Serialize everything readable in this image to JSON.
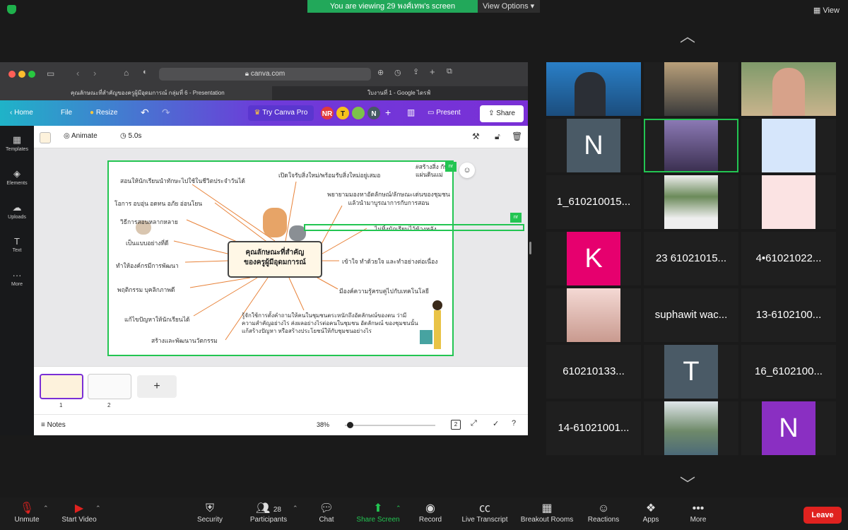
{
  "topbar": {
    "viewing": "You are viewing 29 พงศ์เทพ's screen",
    "view_options": "View Options ▾",
    "view": "View"
  },
  "safari": {
    "url": "canva.com"
  },
  "tabs": [
    {
      "label": "คุณลักษณะที่สำคัญของครูผู้มีอุดมการณ์ กลุ่มที่ 6 - Presentation"
    },
    {
      "label": "ใบงานที่ 1 - Google ไดรฟ์"
    }
  ],
  "canva": {
    "home": "Home",
    "file": "File",
    "resize": "Resize",
    "try_pro": "Try Canva Pro",
    "collab_badges": [
      "NR",
      "T",
      "N"
    ],
    "present": "Present",
    "share": "Share",
    "animate": "Animate",
    "duration": "5.0s"
  },
  "rail": [
    "Templates",
    "Elements",
    "Uploads",
    "Text",
    "More"
  ],
  "slide": {
    "center": [
      "คุณลักษณะที่สำคัญ",
      "ของครูผู้มีอุดมการณ์"
    ],
    "left": [
      "สอนให้นักเรียนนำทักษะไปใช้ในชีวิตประจำวันได้",
      "โอการ อบอุ่น อดทน อภัย อ่อนโยน",
      "วิธีการสอนหลากหลาย",
      "เป็นแบบอย่างที่ดี",
      "ทำให้องค์กรมีการพัฒนา",
      "พฤติกรรม บุคลิกภาพดี",
      "แก้ไขปัญหาให้นักเรียนได้",
      "สร้างและพัฒนานวัตกรรม"
    ],
    "right": [
      "เปิดใจรับสิ่งใหม่/พร้อมรับสิ่งใหม่อยู่เสมอ",
      "#สร้างสิ่ง กับแผ่นดินแม่",
      "พยายามมองหาอัตลักษณ์/ลักษณะเด่นของชุมชน แล้วนำมาบูรณาการกับการสอน",
      "ไม่ทิ้งนักเรียนไว้ข้างหลัง",
      "เข้าใจ ทำด้วยใจ และทำอย่างต่อเนื่อง",
      "มีองค์ความรู้ครบคู่ไปกับเทคโนโลยี",
      "รู้จักใช้การตั้งคำถามให้คนในชุมชนตระหนักถึงอัตลักษณ์ของตน ว่ามีความสำคัญอย่างไร ส่งผลอย่างไรต่อคนในชุมชน อัตลักษณ์ ของชุมชนนั้นแก้สร้างปัญหา หรือสร้างประโยชน์ให้กับชุมชนอย่างไร"
    ],
    "cursor_tag": "nr"
  },
  "pages": {
    "page_numbers": [
      "1",
      "2"
    ],
    "add": "+"
  },
  "notes": {
    "label": "Notes",
    "zoom": "38%",
    "page_count": "2"
  },
  "gallery": [
    {
      "label": ""
    },
    {
      "label": ""
    },
    {
      "label": ""
    },
    {
      "label": "N"
    },
    {
      "label": ""
    },
    {
      "label": ""
    },
    {
      "label": "1_610210015..."
    },
    {
      "label": ""
    },
    {
      "label": ""
    },
    {
      "label": "K"
    },
    {
      "label": "23 61021015..."
    },
    {
      "label": "4•61021022..."
    },
    {
      "label": ""
    },
    {
      "label": "suphawit wac..."
    },
    {
      "label": "13-6102100..."
    },
    {
      "label": "610210133..."
    },
    {
      "label": "T"
    },
    {
      "label": "16_6102100..."
    },
    {
      "label": "14-61021001..."
    },
    {
      "label": ""
    },
    {
      "label": "N"
    }
  ],
  "bottombar": {
    "unmute": "Unmute",
    "start_video": "Start Video",
    "security": "Security",
    "participants": "Participants",
    "participant_count": "28",
    "chat": "Chat",
    "share_screen": "Share Screen",
    "record": "Record",
    "live_transcript": "Live Transcript",
    "breakout": "Breakout Rooms",
    "reactions": "Reactions",
    "apps": "Apps",
    "more": "More",
    "leave": "Leave"
  },
  "colors": {
    "share_green": "#22a85a",
    "canva_purple": "#7a2fd6",
    "leave_red": "#e0221f",
    "avatar_k": "#e6006e",
    "avatar_n2": "#8a2fc2",
    "avatar_slate": "#4a5a66"
  }
}
